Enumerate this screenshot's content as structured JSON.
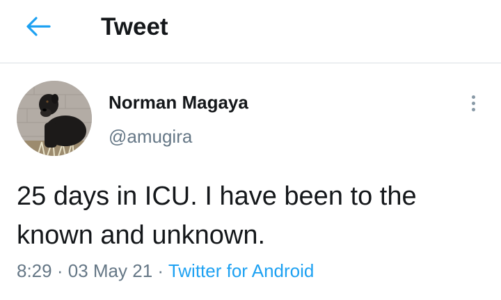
{
  "header": {
    "back_icon": "arrow-left-icon",
    "title": "Tweet",
    "accent_color": "#1da1f2"
  },
  "tweet": {
    "author": {
      "name": "Norman Magaya",
      "handle": "@amugira",
      "avatar_icon": "dog-photo"
    },
    "more_icon": "more-vertical-icon",
    "text": "25 days in ICU. I have been to the known and unknown.",
    "time": "8:29",
    "separator": "·",
    "date": "03 May 21",
    "source": "Twitter for Android"
  },
  "colors": {
    "text_primary": "#14171a",
    "text_secondary": "#657786",
    "link": "#1da1f2",
    "divider": "#d9dee2"
  }
}
